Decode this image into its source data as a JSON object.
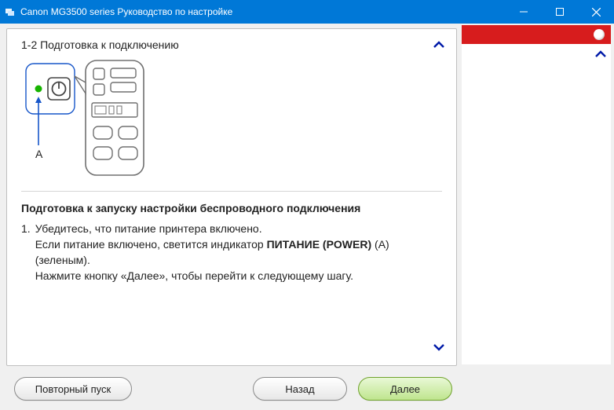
{
  "window": {
    "title": "Canon MG3500 series Руководство по настройке"
  },
  "main": {
    "section_title": "1-2 Подготовка к подключению",
    "illustration_label": "A",
    "heading": "Подготовка к запуску настройки беспроводного подключения",
    "step_number": "1.",
    "line1": "Убедитесь, что питание принтера включено.",
    "line2_pre": "Если питание включено, светится индикатор ",
    "line2_strong": "ПИТАНИЕ (POWER)",
    "line2_post": " (A) (зеленым).",
    "line3": "Нажмите кнопку «Далее», чтобы перейти к следующему шагу."
  },
  "buttons": {
    "restart": "Повторный пуск",
    "back": "Назад",
    "next": "Далее"
  }
}
